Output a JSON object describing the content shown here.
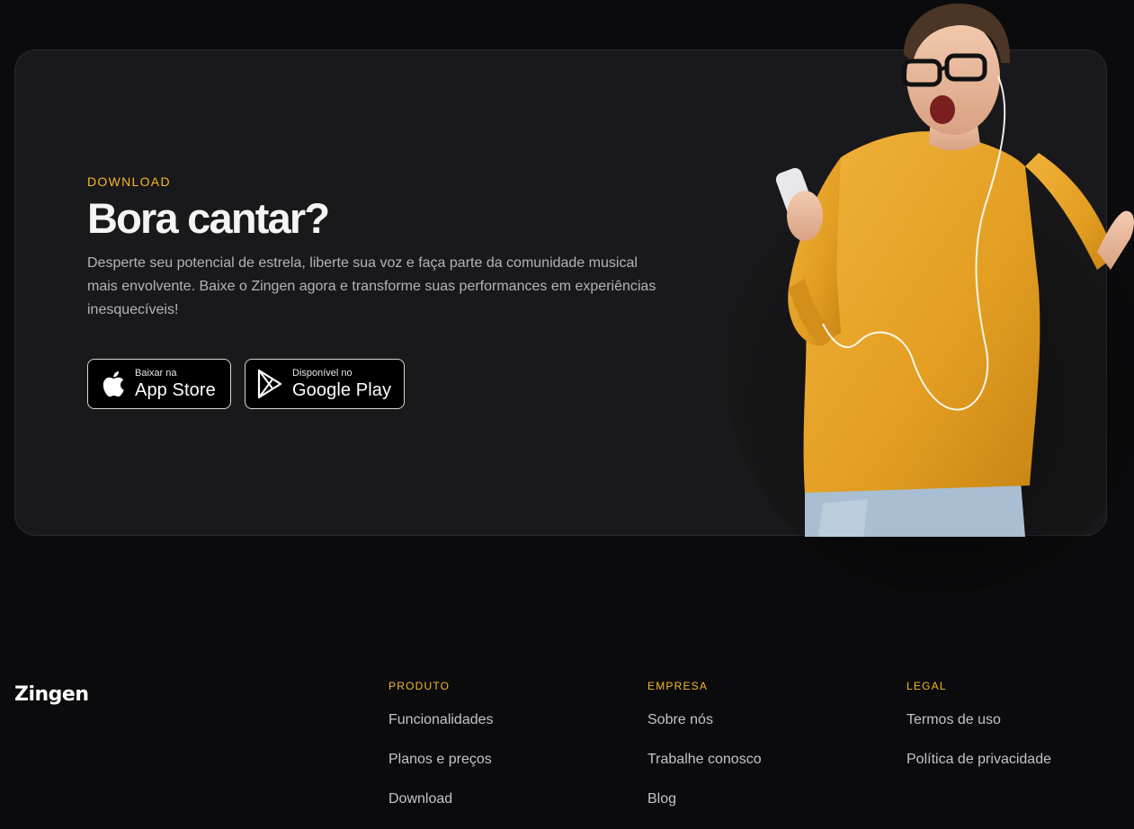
{
  "download": {
    "eyebrow": "DOWNLOAD",
    "headline": "Bora cantar?",
    "description": "Desperte seu potencial de estrela, liberte sua voz e faça parte da comunidade musical mais envolvente. Baixe o Zingen agora e transforme suas performances em experiências inesquecíveis!",
    "app_store": {
      "small": "Baixar na",
      "big": "App Store",
      "icon": "apple-icon"
    },
    "google_play": {
      "small": "Disponível no",
      "big": "Google Play",
      "icon": "google-play-icon"
    }
  },
  "footer": {
    "logo": "Zingen",
    "columns": [
      {
        "title": "PRODUTO",
        "links": [
          "Funcionalidades",
          "Planos e preços",
          "Download"
        ]
      },
      {
        "title": "EMPRESA",
        "links": [
          "Sobre nós",
          "Trabalhe conosco",
          "Blog"
        ]
      },
      {
        "title": "LEGAL",
        "links": [
          "Termos de uso",
          "Política de privacidade"
        ]
      }
    ]
  },
  "colors": {
    "accent": "#f6b72c",
    "background": "#0b0b0d",
    "card": "#19191b"
  }
}
